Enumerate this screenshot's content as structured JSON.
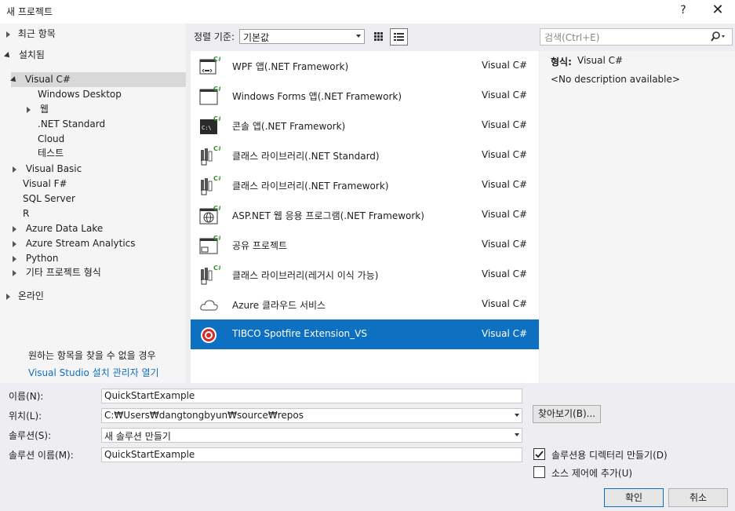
{
  "window": {
    "title": "새 프로젝트",
    "help_label": "?",
    "close_label": "✕"
  },
  "tree": {
    "recent": "최근 항목",
    "installed": "설치됨",
    "visual_csharp": "Visual C#",
    "windows_desktop": "Windows Desktop",
    "web": "웹",
    "net_standard": ".NET Standard",
    "cloud": "Cloud",
    "test": "테스트",
    "visual_basic": "Visual Basic",
    "visual_fsharp": "Visual F#",
    "sql_server": "SQL Server",
    "r": "R",
    "azure_data_lake": "Azure Data Lake",
    "azure_stream": "Azure Stream Analytics",
    "python": "Python",
    "other_types": "기타 프로젝트 형식",
    "online": "온라인",
    "not_found": "원하는 항목을 찾을 수 없을 경우",
    "installer_link": "Visual Studio 설치 관리자 열기"
  },
  "toolbar": {
    "sort_label": "정렬 기준:",
    "sort_value": "기본값",
    "search_placeholder": "검색(Ctrl+E)"
  },
  "templates": [
    {
      "name": "WPF 앱(.NET Framework)",
      "lang": "Visual C#",
      "icon": "wpf-icon"
    },
    {
      "name": "Windows Forms 앱(.NET Framework)",
      "lang": "Visual C#",
      "icon": "winforms-icon"
    },
    {
      "name": "콘솔 앱(.NET Framework)",
      "lang": "Visual C#",
      "icon": "console-icon"
    },
    {
      "name": "클래스 라이브러리(.NET Standard)",
      "lang": "Visual C#",
      "icon": "class-library-icon"
    },
    {
      "name": "클래스 라이브러리(.NET Framework)",
      "lang": "Visual C#",
      "icon": "class-library-icon"
    },
    {
      "name": "ASP.NET 웹 응용 프로그램(.NET Framework)",
      "lang": "Visual C#",
      "icon": "globe-icon"
    },
    {
      "name": "공유 프로젝트",
      "lang": "Visual C#",
      "icon": "shared-project-icon"
    },
    {
      "name": "클래스 라이브러리(레거시 이식 가능)",
      "lang": "Visual C#",
      "icon": "class-library-icon"
    },
    {
      "name": "Azure 클라우드 서비스",
      "lang": "Visual C#",
      "icon": "cloud-icon"
    },
    {
      "name": "TIBCO Spotfire Extension_VS",
      "lang": "Visual C#",
      "icon": "tibco-icon"
    }
  ],
  "description": {
    "type_label": "형식:",
    "type_value": "Visual C#",
    "no_description": "<No description available>"
  },
  "form": {
    "name_label": "이름(N):",
    "name_value": "QuickStartExample",
    "location_label": "위치(L):",
    "location_value": "C:₩Users₩dangtongbyun₩source₩repos",
    "browse_label": "찾아보기(B)...",
    "solution_label": "솔루션(S):",
    "solution_value": "새 솔루션 만들기",
    "solution_name_label": "솔루션 이름(M):",
    "solution_name_value": "QuickStartExample",
    "create_dir_label": "솔루션용 디렉터리 만들기(D)",
    "create_dir_checked": true,
    "source_control_label": "소스 제어에 추가(U)",
    "source_control_checked": false,
    "ok_label": "확인",
    "cancel_label": "취소"
  },
  "colors": {
    "accent": "#0e70c0",
    "selected_row": "#0e70c0",
    "panel": "#f5f5f5",
    "background": "#eeeef2"
  }
}
